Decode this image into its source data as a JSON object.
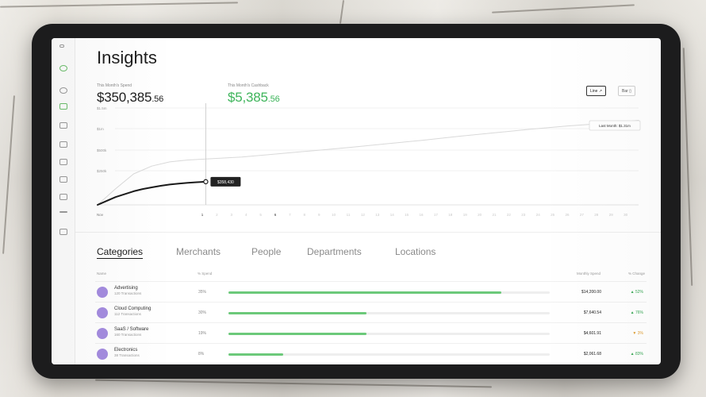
{
  "page": {
    "title": "Insights"
  },
  "kpis": {
    "spend": {
      "label": "This Month's Spend",
      "whole": "$350,385",
      "cents": ".56"
    },
    "cashback": {
      "label": "This Month's Cashback",
      "whole": "$5,385",
      "cents": ".56"
    }
  },
  "chart_controls": {
    "line_label": "Line ↗",
    "bar_label": "Bar ▯"
  },
  "chart_data": {
    "type": "line",
    "y_ticks": [
      "$1.5m",
      "$1m",
      "$500k",
      "$250k"
    ],
    "x_start_label": "Nov",
    "x_ticks": [
      "1",
      "2",
      "3",
      "4",
      "5",
      "6",
      "7",
      "8",
      "9",
      "10",
      "11",
      "12",
      "13",
      "14",
      "15",
      "16",
      "17",
      "18",
      "19",
      "20",
      "21",
      "22",
      "23",
      "24",
      "25",
      "26",
      "27",
      "28",
      "29",
      "30"
    ],
    "ylim": [
      0,
      1500000
    ],
    "series": [
      {
        "style": "light",
        "x": [
          0,
          1,
          2,
          3,
          4,
          5,
          6,
          8,
          10,
          12,
          14,
          16,
          18,
          20,
          22,
          24,
          26,
          28,
          30
        ],
        "y": [
          0,
          250000,
          480000,
          600000,
          665000,
          695000,
          710000,
          740000,
          790000,
          840000,
          890000,
          945000,
          1000000,
          1060000,
          1115000,
          1170000,
          1220000,
          1260000,
          1310000
        ]
      },
      {
        "style": "bold",
        "x": [
          0,
          0.5,
          1,
          1.5,
          2,
          2.5,
          3,
          3.5,
          4,
          4.5,
          5,
          5.5,
          6
        ],
        "y": [
          0,
          60000,
          120000,
          165000,
          210000,
          245000,
          270000,
          295000,
          315000,
          330000,
          342000,
          350000,
          358000
        ]
      }
    ],
    "cursor": {
      "x": 6,
      "y": 358000,
      "label": "$358,430"
    },
    "last_month_label": "Last Month: $1.31m"
  },
  "tabs": [
    {
      "label": "Categories",
      "active": true
    },
    {
      "label": "Merchants",
      "active": false
    },
    {
      "label": "People",
      "active": false
    },
    {
      "label": "Departments",
      "active": false
    },
    {
      "label": "Locations",
      "active": false
    }
  ],
  "table": {
    "headers": {
      "name": "Name",
      "percent": "% Spend",
      "spend": "Monthly Spend",
      "change": "% Change"
    },
    "rows": [
      {
        "name": "Advertising",
        "sub": "120 Transactions",
        "percent": "35%",
        "fill": 0.85,
        "amount": "$14,200.00",
        "change": "▲ 52%",
        "change_color": "#3aa856"
      },
      {
        "name": "Cloud Computing",
        "sub": "112 Transactions",
        "percent": "30%",
        "fill": 0.43,
        "amount": "$7,640.54",
        "change": "▲ 76%",
        "change_color": "#3aa856"
      },
      {
        "name": "SaaS / Software",
        "sub": "160 Transactions",
        "percent": "19%",
        "fill": 0.43,
        "amount": "$4,601.91",
        "change": "▼ 3%",
        "change_color": "#e0a13a"
      },
      {
        "name": "Electronics",
        "sub": "38 Transactions",
        "percent": "8%",
        "fill": 0.17,
        "amount": "$2,061.68",
        "change": "▲ 83%",
        "change_color": "#3aa856"
      }
    ]
  },
  "colors": {
    "accent_green": "#3db45a",
    "bar_green": "#6cc97a",
    "avatar_purple": "#a58de0"
  }
}
